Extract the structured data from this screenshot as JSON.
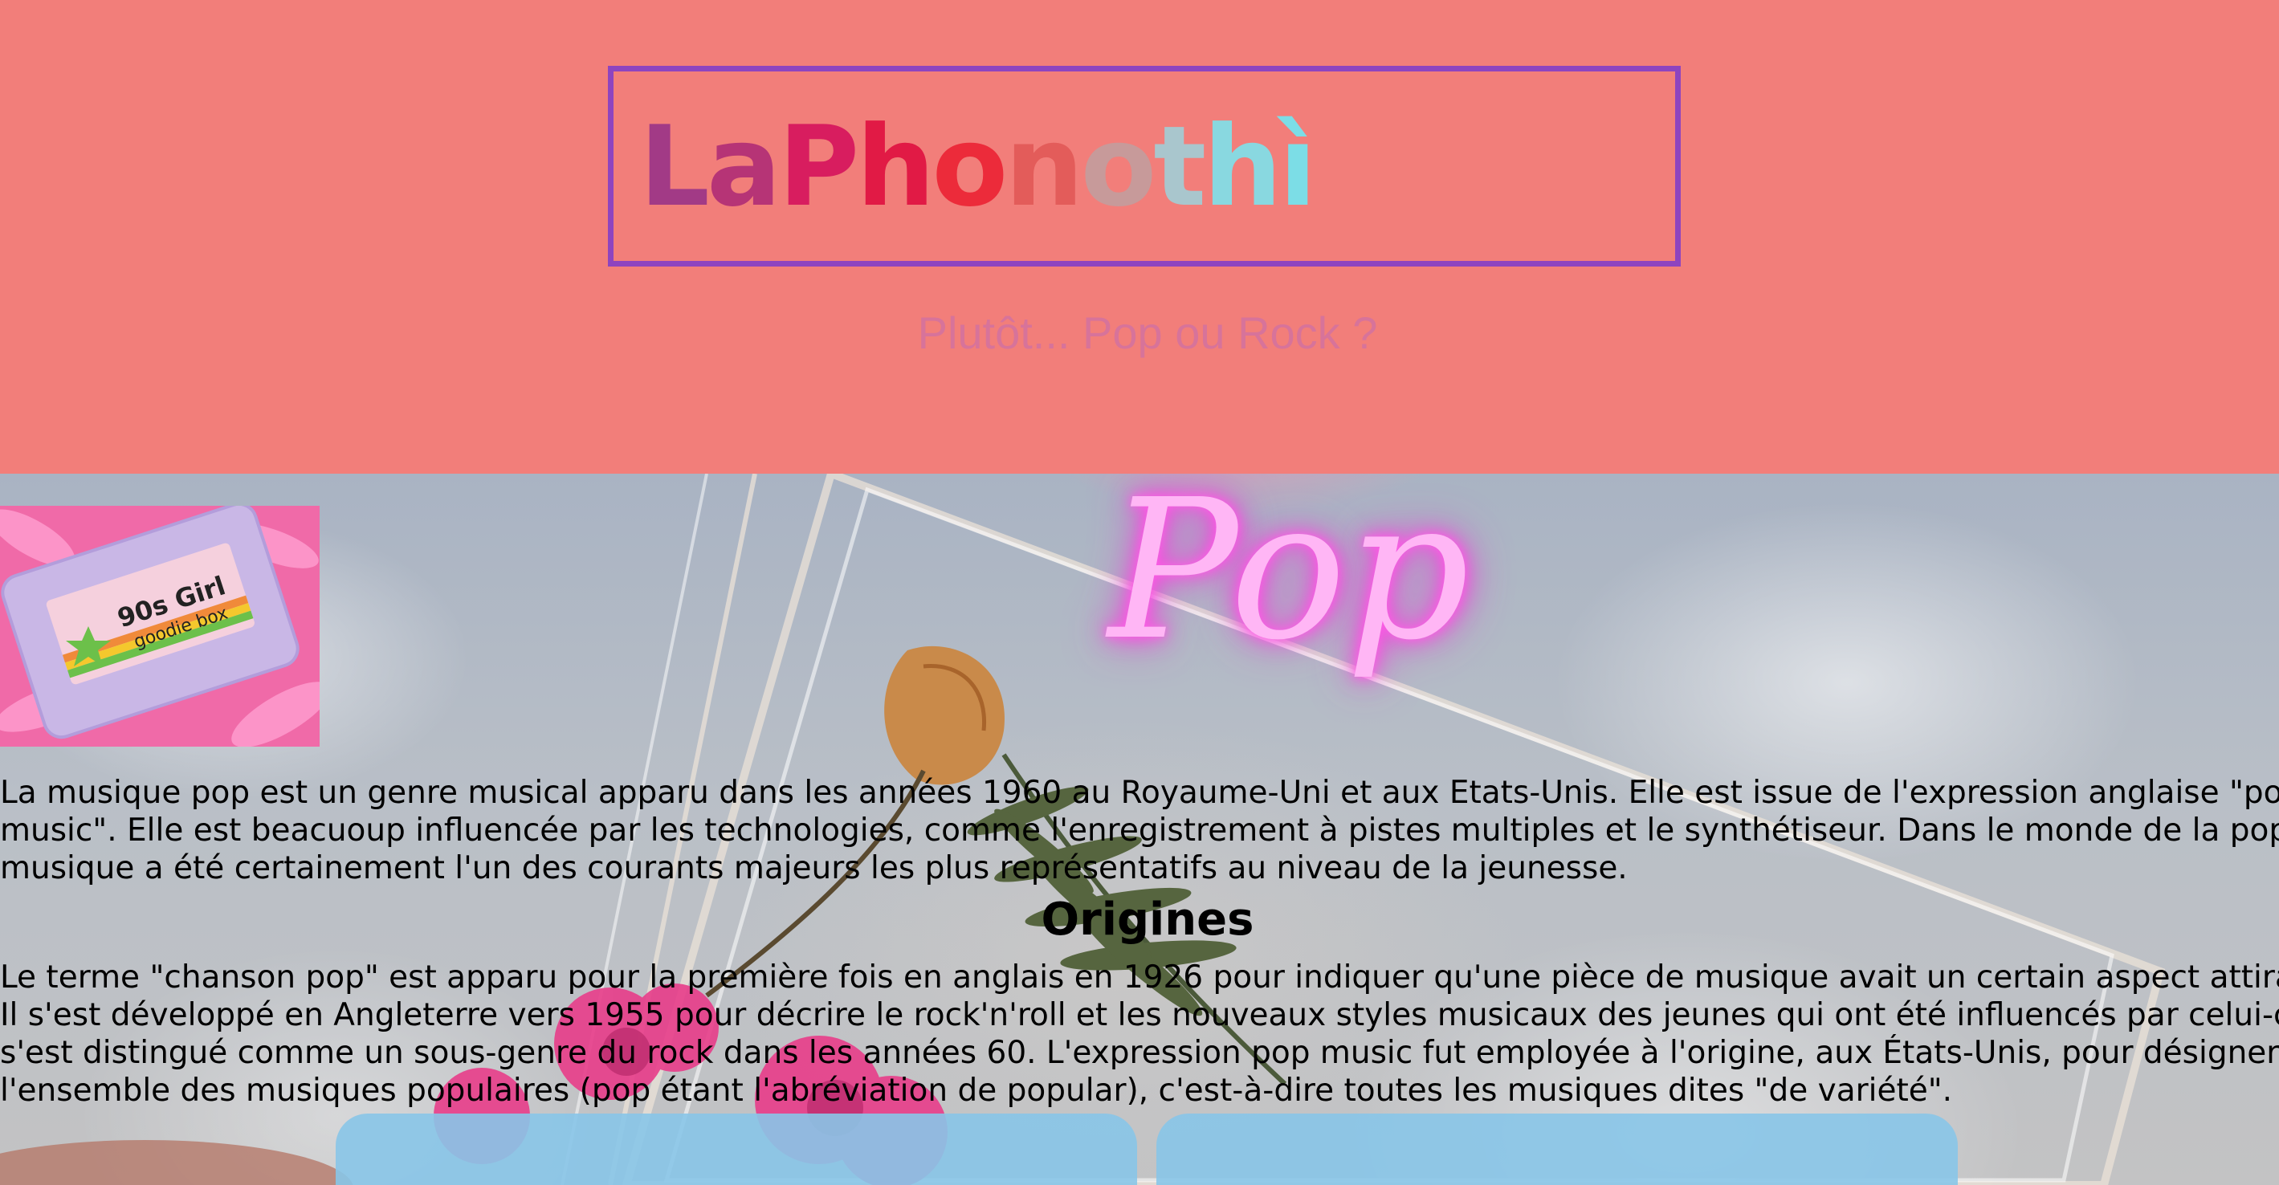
{
  "header": {
    "logo": {
      "text": "LaPhonothì",
      "letters": [
        {
          "char": "L",
          "color": "#a23a86"
        },
        {
          "char": "a",
          "color": "#b63476"
        },
        {
          "char": "P",
          "color": "#d81d5f"
        },
        {
          "char": "h",
          "color": "#e11a45"
        },
        {
          "char": "o",
          "color": "#ec2b3a"
        },
        {
          "char": "n",
          "color": "#e35c5a"
        },
        {
          "char": "o",
          "color": "#c79a9a"
        },
        {
          "char": "t",
          "color": "#a9c6cd"
        },
        {
          "char": "h",
          "color": "#89d8e0"
        },
        {
          "char": "ì",
          "color": "#7cdde6"
        }
      ]
    },
    "tagline": "Plutôt... Pop ou Rock ?"
  },
  "hero": {
    "title": "Pop",
    "title_color": "#ffb6f5",
    "thumbnail": {
      "line1": "90s Girl",
      "line2": "goodie box"
    }
  },
  "intro_lines": [
    "La musique pop est un genre musical apparu dans les années 1960 au Royaume-Uni et aux Etats-Unis. Elle est issue de l'expression anglaise \"popular",
    "music\". Elle est beacuoup influencée par les technologies, comme l'enregistrement à pistes multiples et le synthétiseur. Dans le monde de la pop, la",
    "musique a été certainement l'un des courants majeurs les plus représentatifs au niveau de la jeunesse."
  ],
  "origines": {
    "heading": "Origines",
    "lines": [
      "Le terme \"chanson pop\" est apparu pour la première fois en anglais en 1926 pour indiquer qu'une pièce de musique avait un certain aspect attirant.",
      "Il s'est développé en Angleterre vers 1955 pour décrire le rock'n'roll et les nouveaux styles musicaux des jeunes qui ont été influencés par celui-ci. Il",
      "s'est distingué comme un sous-genre du rock dans les années 60. L'expression pop music fut employée à l'origine, aux États-Unis, pour désigner",
      "l'ensemble des musiques populaires (pop étant l'abréviation de popular), c'est-à-dire toutes les musiques dites \"de variété\"."
    ]
  },
  "colors": {
    "header_bg": "#f27e7a",
    "logo_border": "#8e44bf",
    "tagline": "#d7739a",
    "card": "#88c5e8"
  }
}
